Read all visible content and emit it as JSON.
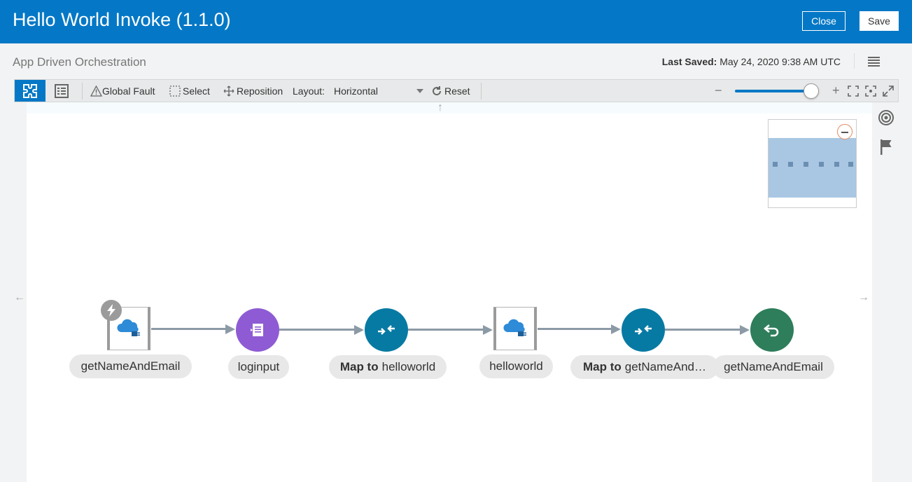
{
  "header": {
    "title": "Hello World Invoke (1.1.0)",
    "close_label": "Close",
    "save_label": "Save"
  },
  "subheader": {
    "type": "App Driven Orchestration",
    "last_saved_label": "Last Saved:",
    "last_saved_value": "May 24, 2020 9:38 AM UTC"
  },
  "toolbar": {
    "global_fault": "Global Fault",
    "select": "Select",
    "reposition": "Reposition",
    "layout_label": "Layout:",
    "layout_value": "Horizontal",
    "reset": "Reset",
    "zoom_minus": "−",
    "zoom_plus": "+",
    "zoom_level": 0.85
  },
  "flow": {
    "nodes": [
      {
        "id": "n1",
        "type": "trigger",
        "label": "getNameAndEmail",
        "color": "#ffffff",
        "icon": "cloud-connector-icon"
      },
      {
        "id": "n2",
        "type": "log",
        "label": "loginput",
        "color": "#8e5bd4",
        "icon": "log-icon"
      },
      {
        "id": "n3",
        "type": "map",
        "label_bold": "Map to",
        "label": "helloworld",
        "color": "#077aa3",
        "icon": "map-icon"
      },
      {
        "id": "n4",
        "type": "invoke",
        "label": "helloworld",
        "color": "#ffffff",
        "icon": "cloud-connector-icon"
      },
      {
        "id": "n5",
        "type": "map",
        "label_bold": "Map to",
        "label": "getNameAnd…",
        "color": "#077aa3",
        "icon": "map-icon"
      },
      {
        "id": "n6",
        "type": "return",
        "label": "getNameAndEmail",
        "color": "#2e7d5b",
        "icon": "return-icon"
      }
    ]
  },
  "colors": {
    "header_bg": "#0478c6",
    "edge": "#8c9aa6"
  }
}
